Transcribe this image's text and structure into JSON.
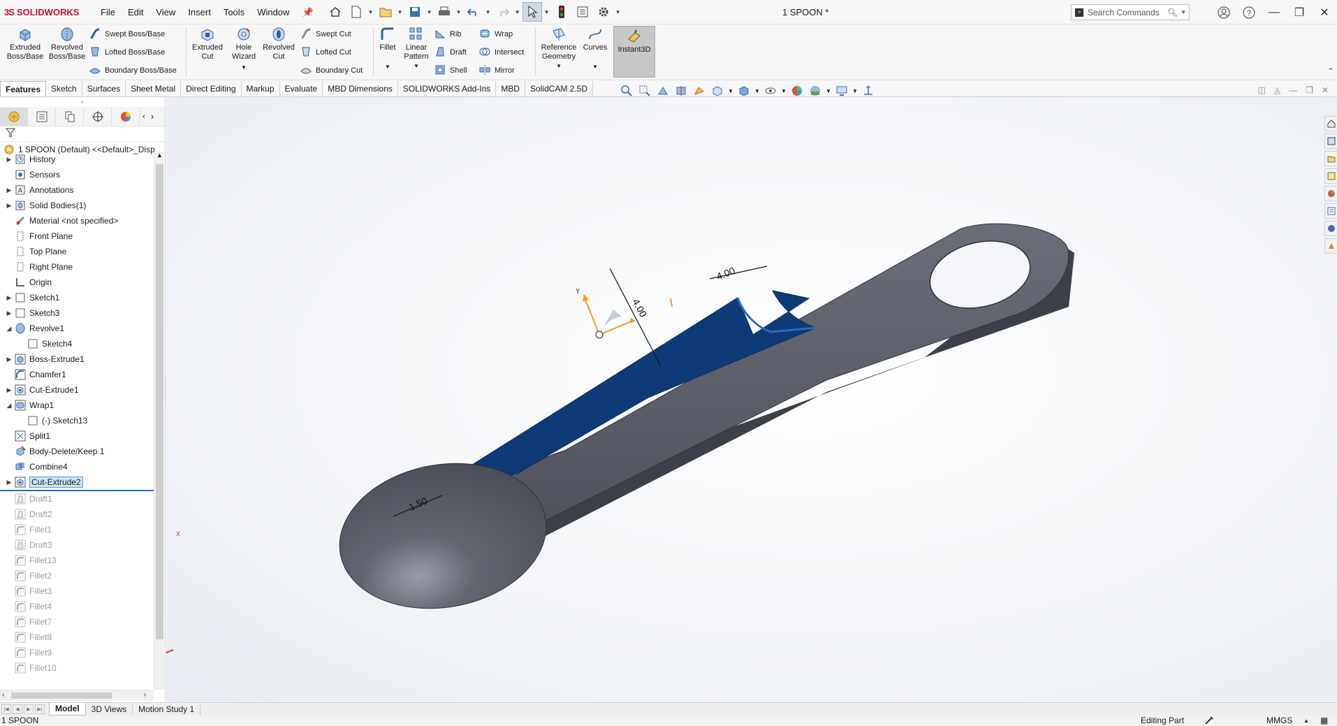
{
  "app": {
    "brand_prefix": "3S",
    "brand": "SOLIDWORKS",
    "document_title": "1 SPOON *",
    "menus": [
      "File",
      "Edit",
      "View",
      "Insert",
      "Tools",
      "Window"
    ]
  },
  "search": {
    "placeholder": "Search Commands"
  },
  "ribbon": {
    "extruded_boss": "Extruded\nBoss/Base",
    "revolved_boss": "Revolved\nBoss/Base",
    "swept_boss": "Swept Boss/Base",
    "lofted_boss": "Lofted Boss/Base",
    "boundary_boss": "Boundary Boss/Base",
    "extruded_cut": "Extruded\nCut",
    "hole_wizard": "Hole\nWizard",
    "revolved_cut": "Revolved\nCut",
    "swept_cut": "Swept Cut",
    "lofted_cut": "Lofted Cut",
    "boundary_cut": "Boundary Cut",
    "fillet": "Fillet",
    "linear_pattern": "Linear\nPattern",
    "rib": "Rib",
    "draft": "Draft",
    "shell": "Shell",
    "wrap": "Wrap",
    "intersect": "Intersect",
    "mirror": "Mirror",
    "reference_geometry": "Reference\nGeometry",
    "curves": "Curves",
    "instant3d": "Instant3D"
  },
  "tabs": [
    "Features",
    "Sketch",
    "Surfaces",
    "Sheet Metal",
    "Direct Editing",
    "Markup",
    "Evaluate",
    "MBD Dimensions",
    "SOLIDWORKS Add-Ins",
    "MBD",
    "SolidCAM 2.5D"
  ],
  "active_tab": "Features",
  "tree": {
    "root": "1 SPOON (Default) <<Default>_Disp",
    "items": [
      {
        "label": "History",
        "icon": "history-icon",
        "expandable": true,
        "indent": 0,
        "suppressed": false
      },
      {
        "label": "Sensors",
        "icon": "sensor-icon",
        "expandable": false,
        "indent": 0,
        "suppressed": false
      },
      {
        "label": "Annotations",
        "icon": "annotation-icon",
        "expandable": true,
        "indent": 0,
        "suppressed": false
      },
      {
        "label": "Solid Bodies(1)",
        "icon": "solid-bodies-icon",
        "expandable": true,
        "indent": 0,
        "suppressed": false
      },
      {
        "label": "Material <not specified>",
        "icon": "material-icon",
        "expandable": false,
        "indent": 0,
        "suppressed": false
      },
      {
        "label": "Front Plane",
        "icon": "plane-icon",
        "expandable": false,
        "indent": 0,
        "suppressed": false
      },
      {
        "label": "Top Plane",
        "icon": "plane-icon",
        "expandable": false,
        "indent": 0,
        "suppressed": false
      },
      {
        "label": "Right Plane",
        "icon": "plane-icon",
        "expandable": false,
        "indent": 0,
        "suppressed": false
      },
      {
        "label": "Origin",
        "icon": "origin-icon",
        "expandable": false,
        "indent": 0,
        "suppressed": false
      },
      {
        "label": "Sketch1",
        "icon": "sketch-icon",
        "expandable": true,
        "indent": 0,
        "suppressed": false
      },
      {
        "label": "Sketch3",
        "icon": "sketch-icon",
        "expandable": true,
        "indent": 0,
        "suppressed": false
      },
      {
        "label": "Revolve1",
        "icon": "revolve-icon",
        "expandable": true,
        "expanded": true,
        "indent": 0,
        "suppressed": false
      },
      {
        "label": "Sketch4",
        "icon": "sketch-icon",
        "expandable": false,
        "indent": 1,
        "suppressed": false
      },
      {
        "label": "Boss-Extrude1",
        "icon": "extrude-icon",
        "expandable": true,
        "indent": 0,
        "suppressed": false
      },
      {
        "label": "Chamfer1",
        "icon": "chamfer-icon",
        "expandable": false,
        "indent": 0,
        "suppressed": false
      },
      {
        "label": "Cut-Extrude1",
        "icon": "cut-extrude-icon",
        "expandable": true,
        "indent": 0,
        "suppressed": false
      },
      {
        "label": "Wrap1",
        "icon": "wrap-icon",
        "expandable": true,
        "expanded": true,
        "indent": 0,
        "suppressed": false
      },
      {
        "label": "(-) Sketch13",
        "icon": "sketch-icon",
        "expandable": false,
        "indent": 1,
        "suppressed": false
      },
      {
        "label": "Split1",
        "icon": "split-icon",
        "expandable": false,
        "indent": 0,
        "suppressed": false
      },
      {
        "label": "Body-Delete/Keep 1",
        "icon": "body-delete-icon",
        "expandable": false,
        "indent": 0,
        "suppressed": false
      },
      {
        "label": "Combine4",
        "icon": "combine-icon",
        "expandable": false,
        "indent": 0,
        "suppressed": false
      },
      {
        "label": "Cut-Extrude2",
        "icon": "cut-extrude-icon",
        "expandable": true,
        "indent": 0,
        "suppressed": false,
        "selected": true
      },
      {
        "label": "Draft1",
        "icon": "draft-icon",
        "expandable": false,
        "indent": 0,
        "suppressed": true
      },
      {
        "label": "Draft2",
        "icon": "draft-icon",
        "expandable": false,
        "indent": 0,
        "suppressed": true
      },
      {
        "label": "Fillet1",
        "icon": "fillet-icon",
        "expandable": false,
        "indent": 0,
        "suppressed": true
      },
      {
        "label": "Draft3",
        "icon": "draft-icon",
        "expandable": false,
        "indent": 0,
        "suppressed": true
      },
      {
        "label": "Fillet13",
        "icon": "fillet-icon",
        "expandable": false,
        "indent": 0,
        "suppressed": true
      },
      {
        "label": "Fillet2",
        "icon": "fillet-icon",
        "expandable": false,
        "indent": 0,
        "suppressed": true
      },
      {
        "label": "Fillet3",
        "icon": "fillet-icon",
        "expandable": false,
        "indent": 0,
        "suppressed": true
      },
      {
        "label": "Fillet4",
        "icon": "fillet-icon",
        "expandable": false,
        "indent": 0,
        "suppressed": true
      },
      {
        "label": "Fillet7",
        "icon": "fillet-icon",
        "expandable": false,
        "indent": 0,
        "suppressed": true
      },
      {
        "label": "Fillet8",
        "icon": "fillet-icon",
        "expandable": false,
        "indent": 0,
        "suppressed": true
      },
      {
        "label": "Fillet9",
        "icon": "fillet-icon",
        "expandable": false,
        "indent": 0,
        "suppressed": true
      },
      {
        "label": "Fillet10",
        "icon": "fillet-icon",
        "expandable": false,
        "indent": 0,
        "suppressed": true
      }
    ]
  },
  "model": {
    "dim_a": "1.50",
    "dim_b": "4.00",
    "dim_c": "4.00",
    "axis_y": "Y",
    "triad_x": "X",
    "triad_y": "Y",
    "colors": {
      "body": "#5a5d68",
      "cut": "#0f3a78",
      "accent": "#2a6bbf"
    }
  },
  "bottom_tabs": [
    "Model",
    "3D Views",
    "Motion Study 1"
  ],
  "active_bottom_tab": "Model",
  "status": {
    "left": "1 SPOON",
    "mode": "Editing Part",
    "units": "MMGS"
  }
}
